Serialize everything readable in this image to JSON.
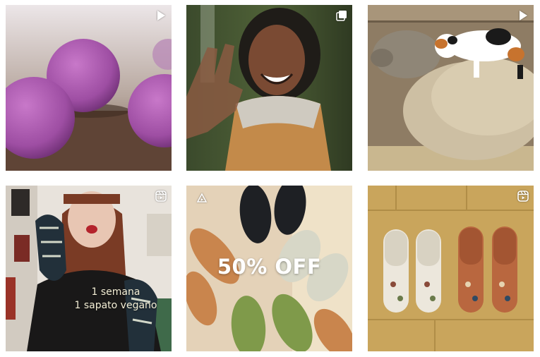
{
  "colors": {
    "icon_white": "#ffffff",
    "caption_color": "#f4efd6"
  },
  "posts": [
    {
      "type": "video",
      "icon": "play-icon",
      "subject": "purple bath bombs"
    },
    {
      "type": "carousel",
      "icon": "carousel-icon",
      "subject": "smiling woman waving"
    },
    {
      "type": "video",
      "icon": "play-icon",
      "subject": "sheep and cat"
    },
    {
      "type": "reel",
      "icon": "reels-icon",
      "subject": "woman holding vegan shoe",
      "caption_line1": "1 semana",
      "caption_line2": "1 sapato vegano"
    },
    {
      "type": "reel",
      "icon": "reels-icon",
      "subject": "assorted shoes",
      "overlay_text": "50% OFF"
    },
    {
      "type": "reel",
      "icon": "reels-icon",
      "subject": "floral slippers on wood floor"
    }
  ]
}
